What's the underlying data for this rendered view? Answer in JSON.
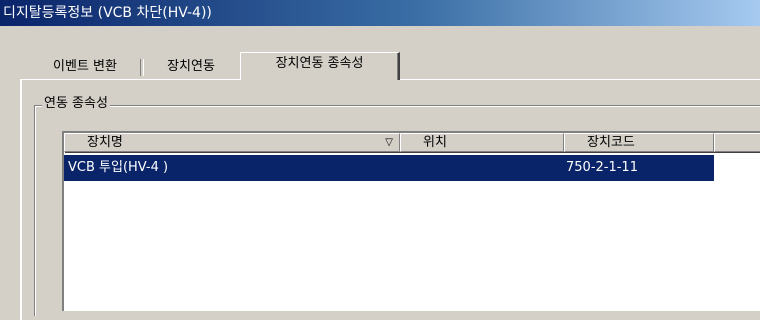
{
  "window": {
    "title": "디지탈등록정보 (VCB 차단(HV-4))"
  },
  "tabs": [
    {
      "label": "이벤트 변환",
      "active": false
    },
    {
      "label": "장치연동",
      "active": false
    },
    {
      "label": "장치연동 종속성",
      "active": true
    }
  ],
  "group": {
    "label": "연동 종속성"
  },
  "listview": {
    "columns": [
      "장치명",
      "위치",
      "장치코드",
      ""
    ],
    "sort_icon": "sort-descending-icon",
    "rows": [
      {
        "name": "VCB 투입(HV-4 )",
        "location": "",
        "code": "750-2-1-11",
        "selected": true
      }
    ]
  },
  "colors": {
    "selection": "#0a246a",
    "title_gradient_start": "#0a246a",
    "title_gradient_end": "#a6caf0"
  }
}
